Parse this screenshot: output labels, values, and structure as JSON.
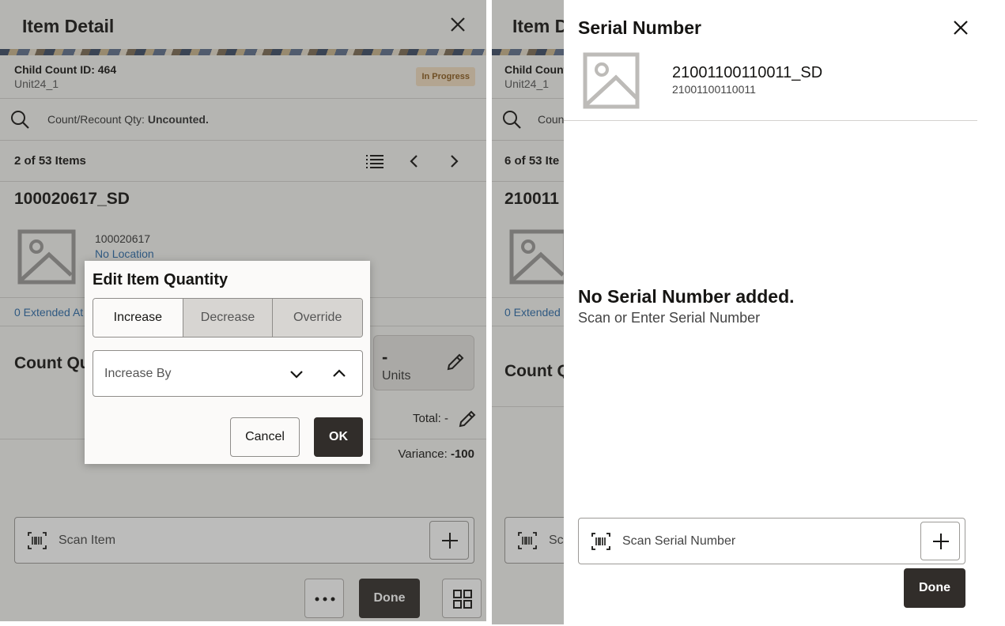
{
  "left": {
    "header": {
      "title": "Item Detail"
    },
    "count": {
      "id_label": "Child Count ID: 464",
      "unit": "Unit24_1",
      "status": "In Progress"
    },
    "search": {
      "label": "Count/Recount Qty:",
      "value": "Uncounted."
    },
    "nav": {
      "position": "2 of 53 Items"
    },
    "item": {
      "title": "100020617_SD",
      "sku": "100020617",
      "location": "No Location"
    },
    "extended_attributes": "0 Extended At",
    "count_qty": {
      "label": "Count Qu",
      "value": "-",
      "units": "Units"
    },
    "total": "Total: -",
    "variance": {
      "label": "Variance:",
      "value": "-100"
    },
    "scan": {
      "placeholder": "Scan Item"
    },
    "footer": {
      "done_label": "Done"
    },
    "dialog": {
      "title": "Edit Item Quantity",
      "tabs": [
        "Increase",
        "Decrease",
        "Override"
      ],
      "active_tab": "Increase",
      "field_label": "Increase By",
      "cancel_label": "Cancel",
      "ok_label": "OK"
    }
  },
  "right": {
    "header": {
      "title": "Item D"
    },
    "count": {
      "id_label": "Child Count",
      "unit": "Unit24_1"
    },
    "search": {
      "label": "Coun"
    },
    "nav": {
      "position": "6 of 53 Ite"
    },
    "item": {
      "title": "210011"
    },
    "extended_attributes": "0 Extended",
    "count_qty": {
      "label": "Count Q"
    },
    "scan": {
      "placeholder": "Sc"
    },
    "drawer": {
      "title": "Serial Number",
      "item_name": "21001100110011_SD",
      "item_sku": "21001100110011",
      "empty_title": "No Serial Number added.",
      "empty_subtitle": "Scan or Enter Serial Number",
      "scan_placeholder": "Scan Serial Number",
      "done_label": "Done"
    }
  }
}
